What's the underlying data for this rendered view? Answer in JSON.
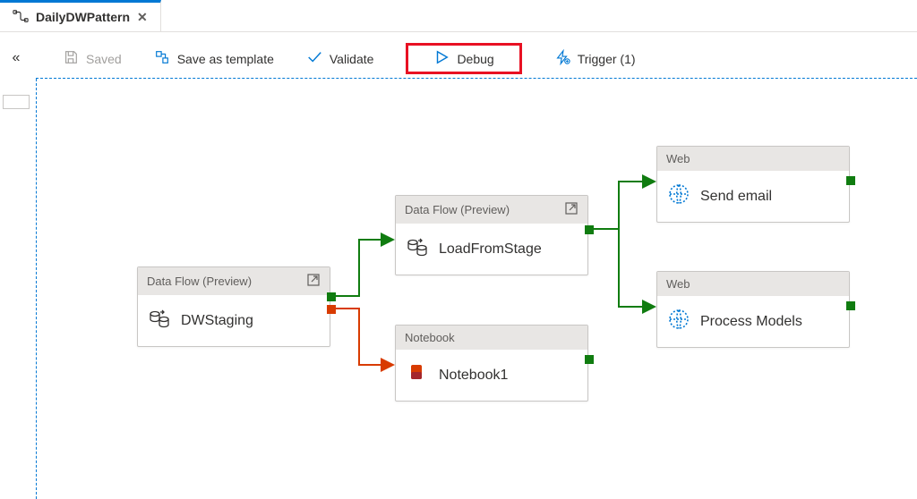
{
  "tab": {
    "title": "DailyDWPattern"
  },
  "toolbar": {
    "saved": "Saved",
    "save_template": "Save as template",
    "validate": "Validate",
    "debug": "Debug",
    "trigger": "Trigger (1)"
  },
  "nodes": {
    "dwstaging": {
      "header": "Data Flow (Preview)",
      "title": "DWStaging"
    },
    "loadfromstage": {
      "header": "Data Flow (Preview)",
      "title": "LoadFromStage"
    },
    "notebook1": {
      "header": "Notebook",
      "title": "Notebook1"
    },
    "sendemail": {
      "header": "Web",
      "title": "Send email"
    },
    "processmodels": {
      "header": "Web",
      "title": "Process Models"
    }
  }
}
